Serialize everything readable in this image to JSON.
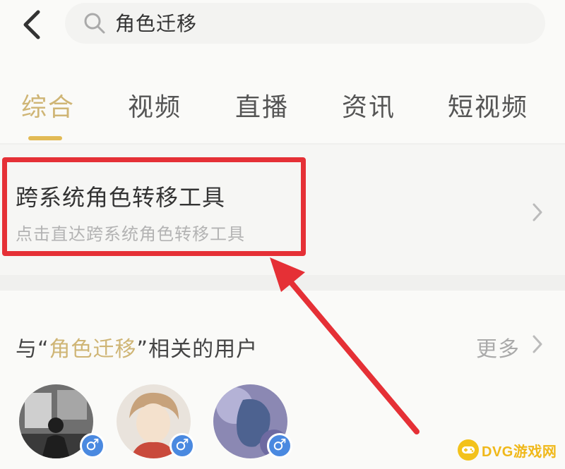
{
  "search": {
    "query": "角色迁移"
  },
  "tabs": [
    {
      "label": "综合"
    },
    {
      "label": "视频"
    },
    {
      "label": "直播"
    },
    {
      "label": "资讯"
    },
    {
      "label": "短视频"
    }
  ],
  "tool_result": {
    "title": "跨系统角色转移工具",
    "subtitle": "点击直达跨系统角色转移工具"
  },
  "related_users": {
    "prefix": "与“",
    "keyword": "角色迁移",
    "suffix": "”相关的用户",
    "more_label": "更多"
  },
  "users": [
    {
      "gender": "♂"
    },
    {
      "gender": "♂"
    },
    {
      "gender": "♂"
    }
  ],
  "watermark": {
    "text": "DVG游戏网"
  },
  "colors": {
    "accent_gold": "#cfb575",
    "highlight_red": "#e53036",
    "gender_blue": "#4a89e0"
  }
}
